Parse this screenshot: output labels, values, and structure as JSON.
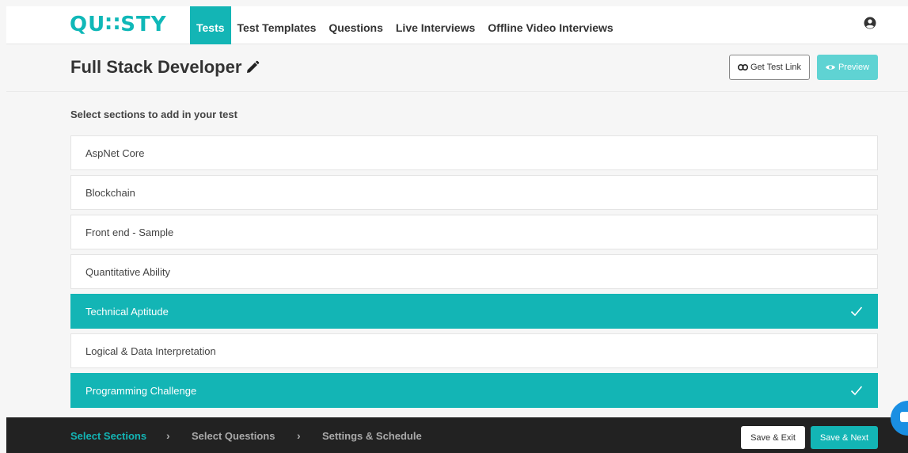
{
  "app": {
    "logo": "QU∷STY"
  },
  "nav": {
    "items": [
      {
        "label": "Tests",
        "active": true
      },
      {
        "label": "Test Templates",
        "active": false
      },
      {
        "label": "Questions",
        "active": false
      },
      {
        "label": "Live Interviews",
        "active": false
      },
      {
        "label": "Offline Video Interviews",
        "active": false
      }
    ]
  },
  "header": {
    "title": "Full Stack Developer",
    "get_link_label": "Get Test Link",
    "preview_label": "Preview"
  },
  "main": {
    "instruction": "Select sections to add in your test",
    "sections": [
      {
        "label": "AspNet Core",
        "selected": false
      },
      {
        "label": "Blockchain",
        "selected": false
      },
      {
        "label": "Front end - Sample",
        "selected": false
      },
      {
        "label": "Quantitative Ability",
        "selected": false
      },
      {
        "label": "Technical Aptitude",
        "selected": true
      },
      {
        "label": "Logical & Data Interpretation",
        "selected": false
      },
      {
        "label": "Programming Challenge",
        "selected": true
      }
    ]
  },
  "footer": {
    "steps": [
      {
        "label": "Select Sections",
        "active": true
      },
      {
        "label": "Select Questions",
        "active": false
      },
      {
        "label": "Settings & Schedule",
        "active": false
      }
    ],
    "chevron": "›",
    "save_exit_label": "Save & Exit",
    "save_next_label": "Save & Next"
  },
  "colors": {
    "accent": "#13b5b5",
    "footer_bg": "#222222",
    "chat": "#1a8fe3"
  },
  "icons": {
    "user": "user-circle-icon",
    "edit": "pencil-icon",
    "link": "link-icon",
    "preview": "eye-icon",
    "check": "check-icon",
    "chat": "chat-icon"
  }
}
